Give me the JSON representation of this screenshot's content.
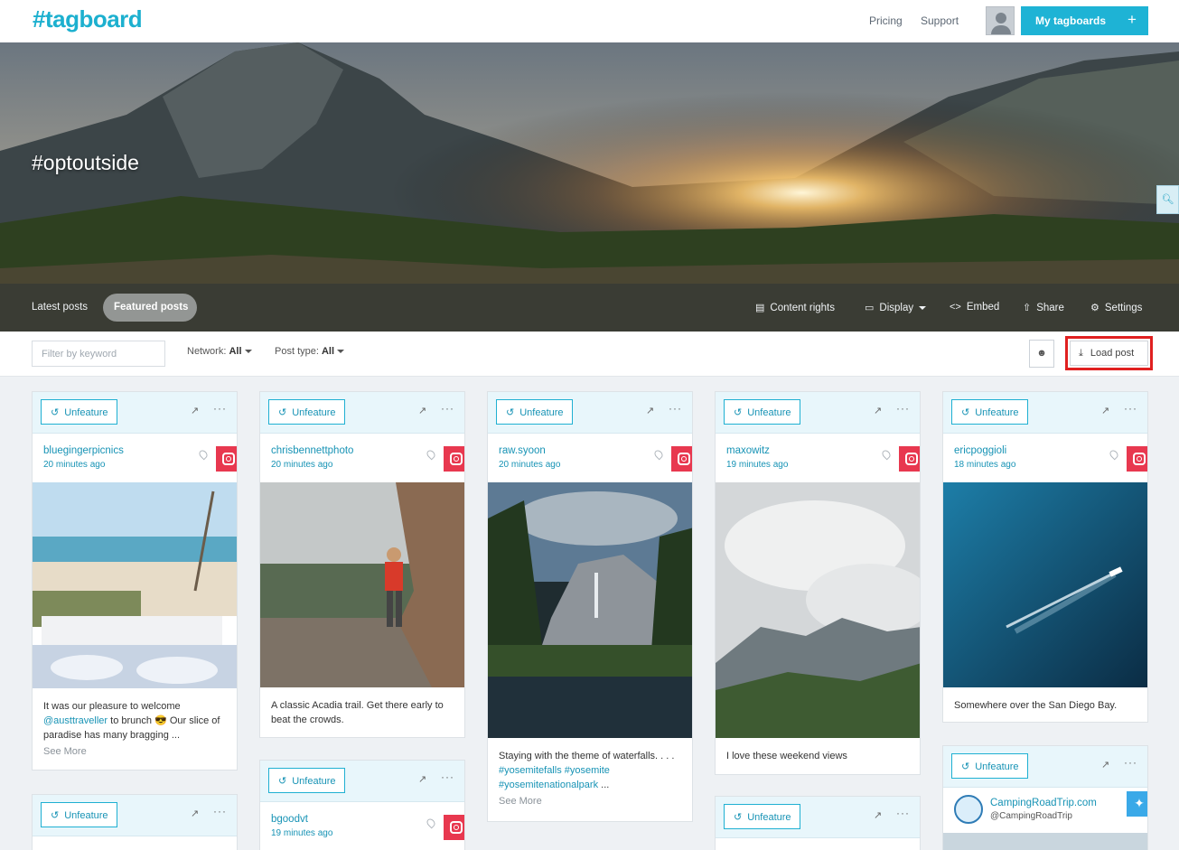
{
  "brand": {
    "logo": "#tagboard",
    "accent": "#1eb3d5",
    "instagram": "#e8384f",
    "twitter": "#3aa9e8"
  },
  "nav": {
    "pricing": "Pricing",
    "support": "Support",
    "my_tagboards": "My tagboards",
    "plus": "+"
  },
  "hero": {
    "hashtag": "#optoutside",
    "tabs": {
      "latest": "Latest posts",
      "featured": "Featured posts"
    },
    "actions": {
      "content_rights": "Content rights",
      "display": "Display",
      "embed": "Embed",
      "share": "Share",
      "settings": "Settings"
    }
  },
  "filters": {
    "keyword_placeholder": "Filter by keyword",
    "network_label": "Network:",
    "network_value": "All",
    "post_type_label": "Post type:",
    "post_type_value": "All",
    "load_post": "Load post"
  },
  "card_common": {
    "unfeature": "Unfeature",
    "see_more": "See More"
  },
  "posts": [
    {
      "user": "bluegingerpicnics",
      "time": "20 minutes ago",
      "network": "instagram",
      "caption_1": "It was our pleasure to welcome",
      "mention": "@austtraveller",
      "caption_2": "to brunch 😎 Our slice of paradise has many bragging ...",
      "see_more": true
    },
    {
      "user": "chrisbennettphoto",
      "time": "20 minutes ago",
      "network": "instagram",
      "caption": "A classic Acadia trail. Get there early to beat the crowds."
    },
    {
      "user": "raw.syoon",
      "time": "20 minutes ago",
      "network": "instagram",
      "caption_1": "Staying with the theme of waterfalls. . . .",
      "tags": "#yosemitefalls #yosemite #yosemitenationalpark",
      "caption_2": "...",
      "see_more": true
    },
    {
      "user": "maxowitz",
      "time": "19 minutes ago",
      "network": "instagram",
      "caption": "I love these weekend views"
    },
    {
      "user": "ericpoggioli",
      "time": "18 minutes ago",
      "network": "instagram",
      "caption": "Somewhere over the San Diego Bay."
    },
    {
      "user": "bgoodvt",
      "time": "19 minutes ago",
      "network": "instagram"
    },
    {
      "user": "CampingRoadTrip.com",
      "handle": "@CampingRoadTrip",
      "network": "twitter"
    }
  ]
}
